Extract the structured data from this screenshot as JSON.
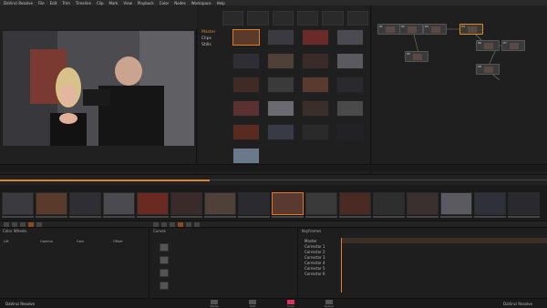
{
  "menubar": {
    "items": [
      "DaVinci Resolve",
      "File",
      "Edit",
      "Trim",
      "Timeline",
      "Clip",
      "Mark",
      "View",
      "Playback",
      "Color",
      "Nodes",
      "Workspace",
      "Help"
    ]
  },
  "viewer": {
    "timecode": "01:00:20:04"
  },
  "media": {
    "folders": [
      "Master",
      "Clips",
      "Stills"
    ],
    "active_folder": "Master",
    "clip_count": 24
  },
  "timeline": {
    "clip_count": 16,
    "selected_index": 8
  },
  "bottom": {
    "panels": [
      "Color Wheels",
      "Curves",
      "Keyframes"
    ],
    "keyframe_rows": [
      "Master",
      "Corrector 1",
      "Corrector 2",
      "Corrector 3",
      "Corrector 4",
      "Corrector 5",
      "Corrector 6"
    ],
    "wheel_labels": [
      "Lift",
      "Gamma",
      "Gain",
      "Offset"
    ]
  },
  "footer": {
    "brand": "DaVinci Resolve",
    "pages": [
      "Media",
      "Edit",
      "Color",
      "Deliver"
    ],
    "active_page": "Color"
  },
  "colors": {
    "accent": "#e08030",
    "selection": "#e07a20",
    "color_page": "#e03060",
    "background": "#1b1b1b"
  }
}
